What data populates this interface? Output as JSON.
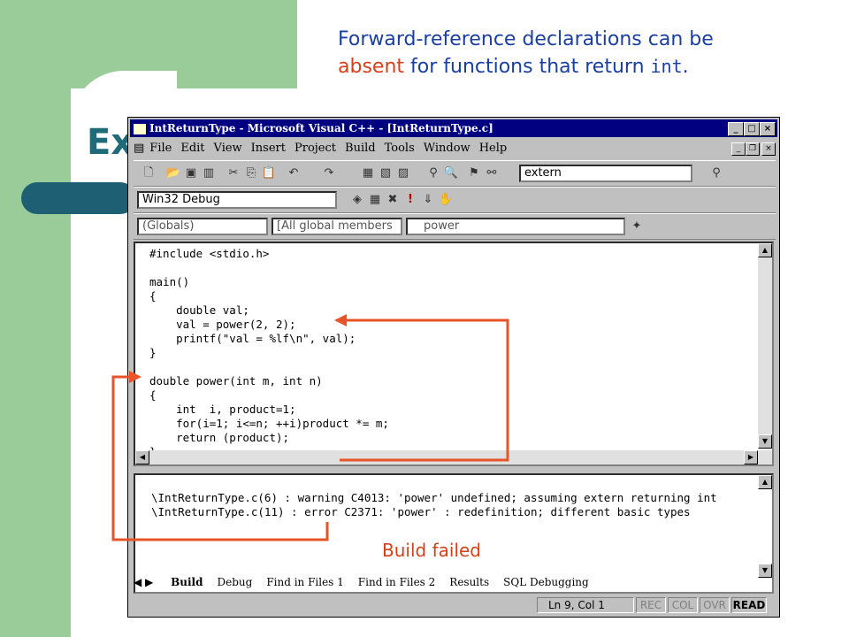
{
  "slide": {
    "title_visible": "Ex",
    "caption_line1": "Forward-reference declarations can be",
    "caption_absent": "absent",
    "caption_line2_mid": " for functions that return ",
    "caption_code": "int",
    "caption_end": ".",
    "annotation": "Build failed"
  },
  "window": {
    "title": "IntReturnType - Microsoft Visual C++ - [IntReturnType.c]",
    "title_buttons": [
      "_",
      "□",
      "×"
    ],
    "menu": [
      "File",
      "Edit",
      "View",
      "Insert",
      "Project",
      "Build",
      "Tools",
      "Window",
      "Help"
    ],
    "find_combo": "extern",
    "config_combo": "Win32 Debug",
    "wizard": {
      "class_combo": "(Globals)",
      "filter_combo": "[All global members",
      "member_combo": "power"
    }
  },
  "code_lines": [
    "#include <stdio.h>",
    "",
    "main()",
    "{",
    "    double val;",
    "    val = power(2, 2);",
    "    printf(\"val = %lf\\n\", val);",
    "}",
    "",
    "double power(int m, int n)",
    "{",
    "    int  i, product=1;",
    "    for(i=1; i<=n; ++i)product *= m;",
    "    return (product);",
    "}"
  ],
  "output": {
    "lines": [
      "\\IntReturnType.c(6) : warning C4013: 'power' undefined; assuming extern returning int",
      "\\IntReturnType.c(11) : error C2371: 'power' : redefinition; different basic types"
    ],
    "tabs": [
      "Build",
      "Debug",
      "Find in Files 1",
      "Find in Files 2",
      "Results",
      "SQL Debugging"
    ]
  },
  "status": {
    "position": "Ln 9, Col 1",
    "rec": "REC",
    "col": "COL",
    "ovr": "OVR",
    "read": "READ"
  },
  "colors": {
    "accent_green": "#99cc99",
    "title_teal": "#1f6b7a",
    "arrow_red": "#e8542a",
    "caption_blue": "#1a3fa0",
    "caption_red": "#d6401a"
  }
}
